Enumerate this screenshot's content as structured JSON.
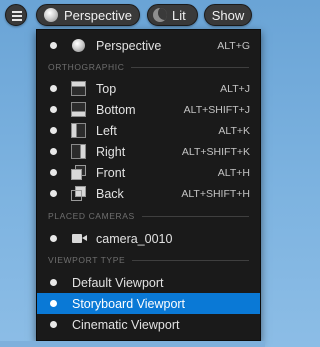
{
  "toolbar": {
    "menu_icon": "hamburger-icon",
    "perspective_label": "Perspective",
    "lit_label": "Lit",
    "show_label": "Show"
  },
  "menu": {
    "perspective": {
      "label": "Perspective",
      "shortcut": "ALT+G",
      "icon": "sphere-icon"
    },
    "sections": {
      "orthographic": "ORTHOGRAPHIC",
      "placed_cameras": "PLACED CAMERAS",
      "viewport_type": "VIEWPORT TYPE"
    },
    "ortho": [
      {
        "label": "Top",
        "shortcut": "ALT+J",
        "icon": "top-view-icon"
      },
      {
        "label": "Bottom",
        "shortcut": "ALT+SHIFT+J",
        "icon": "bottom-view-icon"
      },
      {
        "label": "Left",
        "shortcut": "ALT+K",
        "icon": "left-view-icon"
      },
      {
        "label": "Right",
        "shortcut": "ALT+SHIFT+K",
        "icon": "right-view-icon"
      },
      {
        "label": "Front",
        "shortcut": "ALT+H",
        "icon": "front-view-icon"
      },
      {
        "label": "Back",
        "shortcut": "ALT+SHIFT+H",
        "icon": "back-view-icon"
      }
    ],
    "cameras": [
      {
        "label": "camera_0010",
        "icon": "camera-icon"
      }
    ],
    "viewport_types": [
      {
        "label": "Default Viewport",
        "selected": false
      },
      {
        "label": "Storyboard Viewport",
        "selected": true
      },
      {
        "label": "Cinematic Viewport",
        "selected": false
      }
    ]
  },
  "colors": {
    "menu_bg": "#1a1a1a",
    "selected": "#0a79d6",
    "sky": "#7db3e0"
  }
}
